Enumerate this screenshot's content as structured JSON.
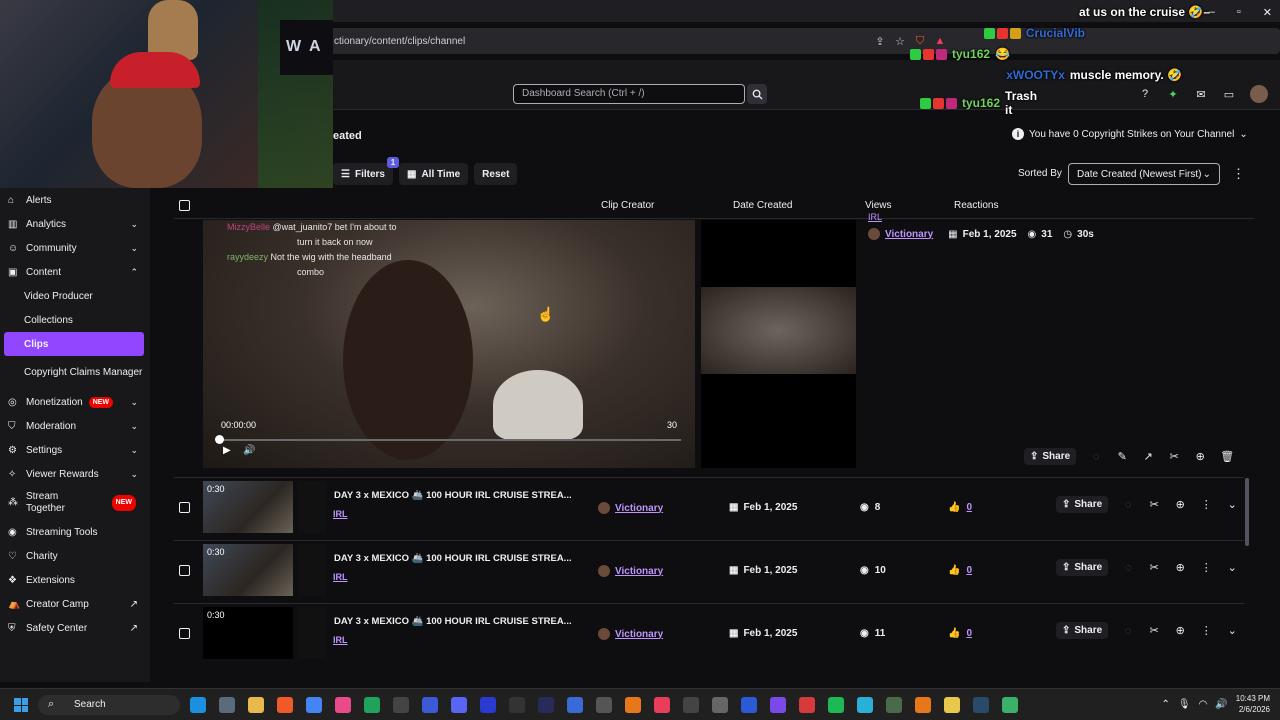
{
  "browser": {
    "url": "ctionary/content/clips/channel"
  },
  "header": {
    "search_placeholder": "Dashboard Search (Ctrl + /)"
  },
  "webcam": {
    "poster_text": "W A"
  },
  "chat": [
    {
      "user": "CrucialVib",
      "message": "at us on the cruise 🤣–",
      "color": "blue"
    },
    {
      "user": "tyu162",
      "message": "😂",
      "color": "green"
    },
    {
      "user": "xWOOTYx",
      "message": "muscle memory. 🤣",
      "color": "blue"
    },
    {
      "user": "tyu162",
      "message": "Trash it",
      "color": "green"
    }
  ],
  "page": {
    "crumb": "eated",
    "copyright_strikes": "You have 0 Copyright Strikes on Your Channel",
    "toolbar": {
      "filters": "Filters",
      "filters_badge": "1",
      "all_time": "All Time",
      "reset": "Reset"
    },
    "sorted_by_label": "Sorted By",
    "sorted_by_value": "Date Created (Newest First)"
  },
  "sidebar": {
    "items": [
      {
        "label": "Alerts",
        "icon": "bell-icon"
      },
      {
        "label": "Analytics",
        "icon": "chart-icon"
      },
      {
        "label": "Community",
        "icon": "people-icon"
      },
      {
        "label": "Content",
        "icon": "film-icon"
      }
    ],
    "content_sub": [
      "Video Producer",
      "Collections",
      "Clips",
      "Copyright Claims Manager"
    ],
    "items2": [
      {
        "label": "Monetization",
        "badge": "NEW"
      },
      {
        "label": "Moderation"
      },
      {
        "label": "Settings"
      },
      {
        "label": "Viewer Rewards"
      },
      {
        "label": "Stream Together",
        "badge": "NEW"
      },
      {
        "label": "Streaming Tools"
      },
      {
        "label": "Charity"
      },
      {
        "label": "Extensions"
      },
      {
        "label": "Creator Camp"
      },
      {
        "label": "Safety Center"
      }
    ]
  },
  "table": {
    "headers": {
      "clip_creator": "Clip Creator",
      "date_created": "Date Created",
      "views": "Views",
      "reactions": "Reactions"
    },
    "expanded": {
      "chat_lines": [
        {
          "name": "MizzyBelle",
          "text": "@wat_juanito7 bet I'm about to"
        },
        {
          "name": "",
          "text": "turn it back on now"
        },
        {
          "name": "rayydeezy",
          "text": "Not the wig with the headband"
        },
        {
          "name": "",
          "text": "combo"
        }
      ],
      "time_current": "00:00:00",
      "time_end": "30",
      "category": "IRL",
      "creator": "Victionary",
      "date": "Feb 1, 2025",
      "views": "31",
      "duration": "30s",
      "share_label": "Share"
    },
    "rows": [
      {
        "duration": "0:30",
        "title": "DAY 3 x MEXICO 🚢 100 HOUR IRL CRUISE STREA...",
        "category": "IRL",
        "creator": "Victionary",
        "date": "Feb 1, 2025",
        "views": "8",
        "likes": "0",
        "share": "Share"
      },
      {
        "duration": "0:30",
        "title": "DAY 3 x MEXICO 🚢 100 HOUR IRL CRUISE STREA...",
        "category": "IRL",
        "creator": "Victionary",
        "date": "Feb 1, 2025",
        "views": "10",
        "likes": "0",
        "share": "Share"
      },
      {
        "duration": "0:30",
        "title": "DAY 3 x MEXICO 🚢 100 HOUR IRL CRUISE STREA...",
        "category": "IRL",
        "creator": "Victionary",
        "date": "Feb 1, 2025",
        "views": "11",
        "likes": "0",
        "share": "Share"
      }
    ]
  },
  "taskbar": {
    "search": "Search",
    "time": "10:43 PM",
    "date": "2/6/2026"
  }
}
